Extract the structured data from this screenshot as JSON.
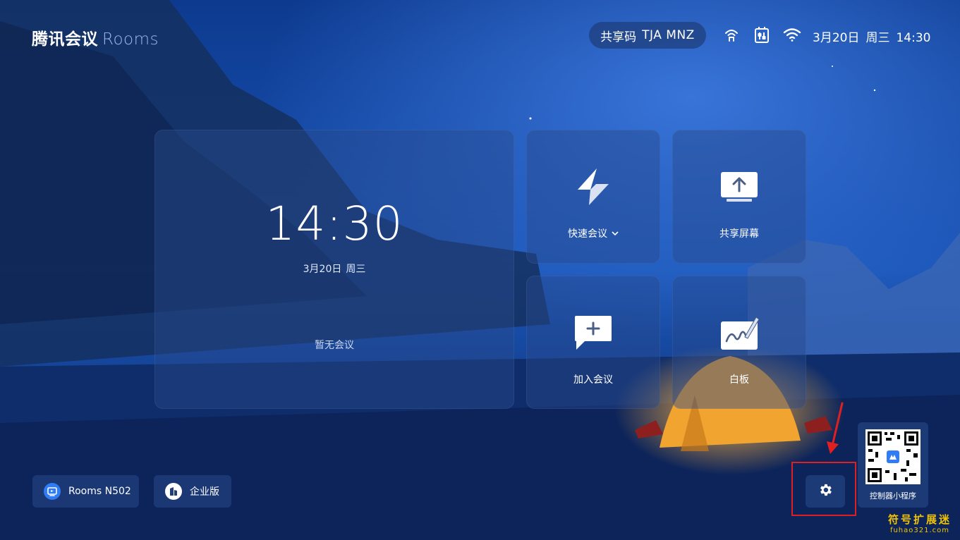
{
  "header": {
    "brand_zh": "腾讯会议",
    "brand_en": "Rooms",
    "share_label": "共享码",
    "share_code": "TJA MNZ",
    "date": "3月20日",
    "weekday": "周三",
    "time": "14:30"
  },
  "clock_panel": {
    "time": "14:30",
    "date": "3月20日",
    "weekday": "周三",
    "status": "暂无会议"
  },
  "tiles": [
    {
      "label": "快速会议",
      "icon": "lightning-icon",
      "has_dropdown": true
    },
    {
      "label": "共享屏幕",
      "icon": "share-screen-icon"
    },
    {
      "label": "加入会议",
      "icon": "join-meeting-icon"
    },
    {
      "label": "白板",
      "icon": "whiteboard-icon"
    }
  ],
  "bottom": {
    "room_name": "Rooms N502",
    "edition": "企业版",
    "qr_label": "控制器小程序"
  },
  "watermark": {
    "line1": "符号扩展迷",
    "line2": "fuhao321.com"
  },
  "colors": {
    "accent_blue": "#2f7cf6",
    "highlight_red": "#e02020",
    "watermark_yellow": "#f2c400"
  }
}
